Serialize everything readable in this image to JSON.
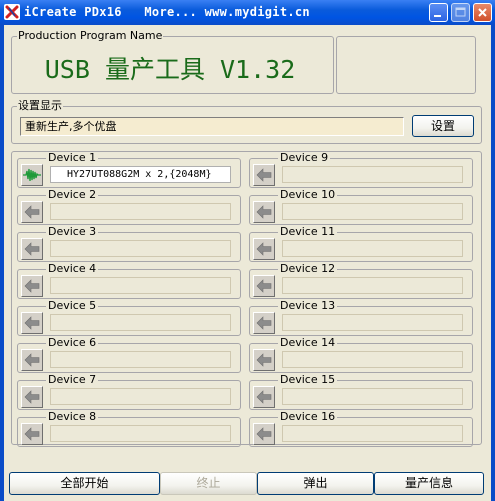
{
  "window": {
    "title": "iCreate PDx16   More... www.mydigit.cn"
  },
  "program_group": {
    "label": "Production Program Name",
    "program_name": "USB 量产工具 V1.32"
  },
  "settings_group": {
    "label": "设置显示",
    "status_text": "重新生产,多个优盘",
    "settings_button": "设置"
  },
  "devices": [
    {
      "label": "Device 1",
      "value": "HY27UT088G2M x 2,{2048M}",
      "active": true
    },
    {
      "label": "Device 2",
      "value": "",
      "active": false
    },
    {
      "label": "Device 3",
      "value": "",
      "active": false
    },
    {
      "label": "Device 4",
      "value": "",
      "active": false
    },
    {
      "label": "Device 5",
      "value": "",
      "active": false
    },
    {
      "label": "Device 6",
      "value": "",
      "active": false
    },
    {
      "label": "Device 7",
      "value": "",
      "active": false
    },
    {
      "label": "Device 8",
      "value": "",
      "active": false
    },
    {
      "label": "Device 9",
      "value": "",
      "active": false
    },
    {
      "label": "Device 10",
      "value": "",
      "active": false
    },
    {
      "label": "Device 11",
      "value": "",
      "active": false
    },
    {
      "label": "Device 12",
      "value": "",
      "active": false
    },
    {
      "label": "Device 13",
      "value": "",
      "active": false
    },
    {
      "label": "Device 14",
      "value": "",
      "active": false
    },
    {
      "label": "Device 15",
      "value": "",
      "active": false
    },
    {
      "label": "Device 16",
      "value": "",
      "active": false
    }
  ],
  "buttons": {
    "start_all": "全部开始",
    "stop": "终止",
    "eject": "弹出",
    "info": "量产信息"
  },
  "colors": {
    "title_bar": "#0054E3",
    "program_name": "#1A6B1A",
    "window_bg": "#ECE9D8",
    "status_bg": "#F5ECD0",
    "active_icon_wave": "#1F9A3A",
    "disabled_text": "#ACA899"
  },
  "icons": {
    "app": "x-tools-icon",
    "active_device": "usb-activity-icon",
    "idle_device": "left-arrow-icon"
  }
}
